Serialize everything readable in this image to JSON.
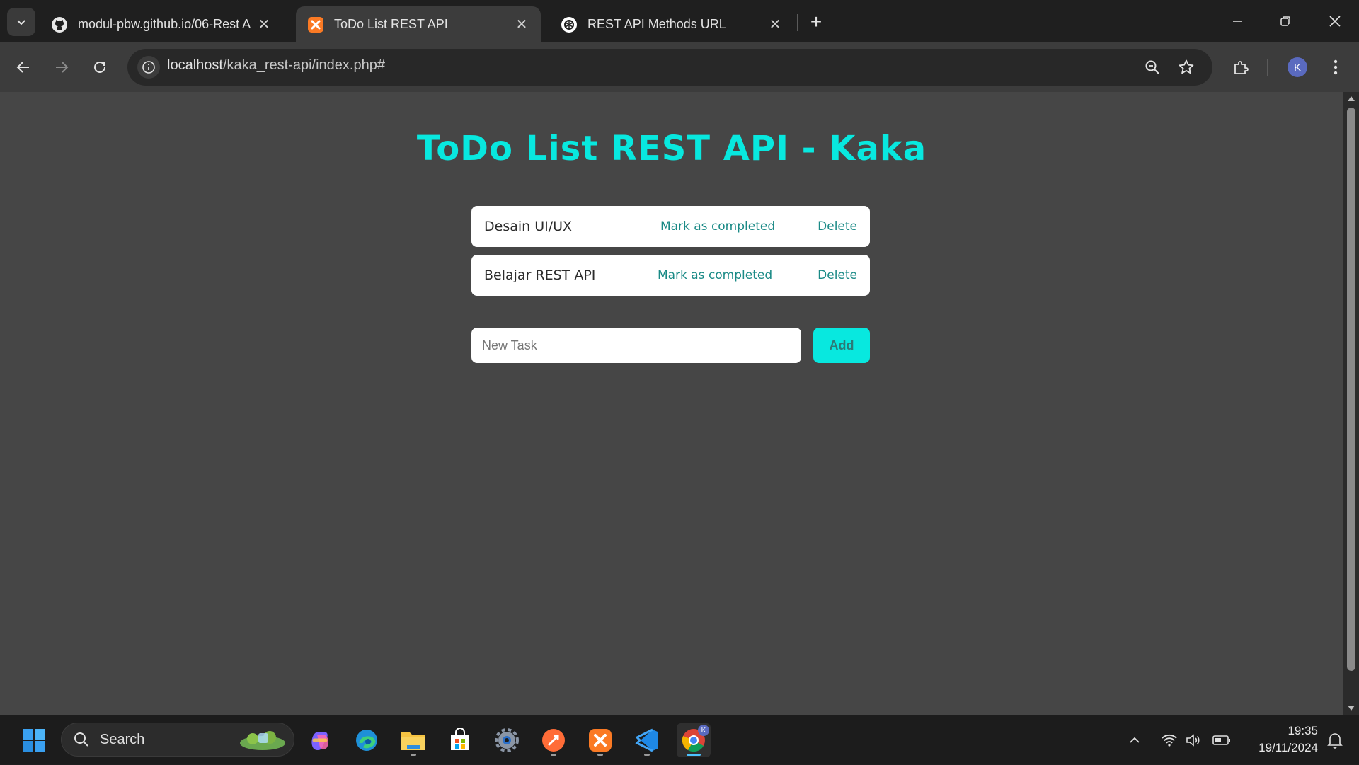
{
  "browser": {
    "tabs": [
      {
        "title": "modul-pbw.github.io/06-Rest A",
        "icon": "github-icon",
        "active": false
      },
      {
        "title": "ToDo List REST API",
        "icon": "xampp-icon",
        "active": true
      },
      {
        "title": "REST API Methods URL",
        "icon": "chatgpt-icon",
        "active": false
      }
    ],
    "new_tab": "+",
    "url_host": "localhost",
    "url_path": "/kaka_rest-api/index.php#",
    "profile_initial": "K"
  },
  "page": {
    "title": "ToDo List REST API - Kaka",
    "tasks": [
      {
        "text": "Desain UI/UX",
        "mark_label": "Mark as completed",
        "delete_label": "Delete"
      },
      {
        "text": "Belajar REST API",
        "mark_label": "Mark as completed",
        "delete_label": "Delete"
      }
    ],
    "new_task_placeholder": "New Task",
    "new_task_value": "",
    "add_label": "Add",
    "accent_color": "#08e8df",
    "link_color": "#1a8a86"
  },
  "taskbar": {
    "search_label": "Search",
    "apps": [
      "windows-start-icon",
      "copilot-icon",
      "edge-icon",
      "file-explorer-icon",
      "microsoft-store-icon",
      "settings-icon",
      "postman-icon",
      "xampp-icon",
      "vscode-icon",
      "chrome-icon"
    ],
    "time": "19:35",
    "date": "19/11/2024"
  }
}
